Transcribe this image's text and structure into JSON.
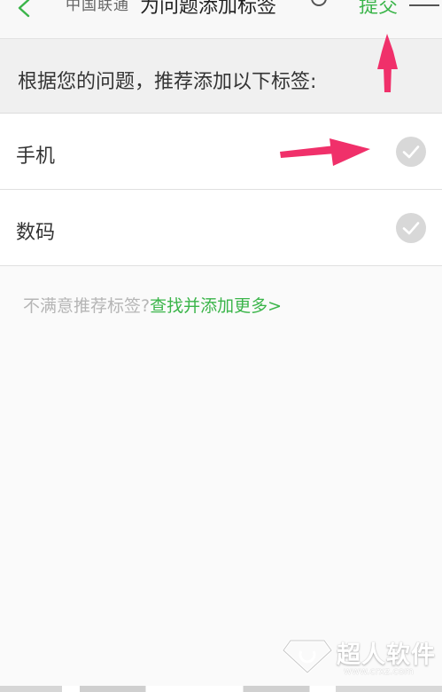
{
  "topbar": {
    "back_icon": "chevron-left-icon",
    "status_text": "中国联通",
    "title": "为问题添加标签",
    "search_icon": "search-icon",
    "submit_label": "提交",
    "menu_icon": "menu-icon"
  },
  "recommend": {
    "text": "根据您的问题，推荐添加以下标签:"
  },
  "tags": [
    {
      "label": "手机",
      "checked": true
    },
    {
      "label": "数码",
      "checked": true
    }
  ],
  "hint": {
    "prefix": "不满意推荐标签?",
    "link": "查找并添加更多>"
  },
  "watermark": {
    "brand": "超人软件",
    "url": "www.crxz.com"
  },
  "colors": {
    "accent_green": "#3bb54a",
    "annotation_arrow": "#f0306a",
    "check_circle": "#d8d8d8"
  }
}
